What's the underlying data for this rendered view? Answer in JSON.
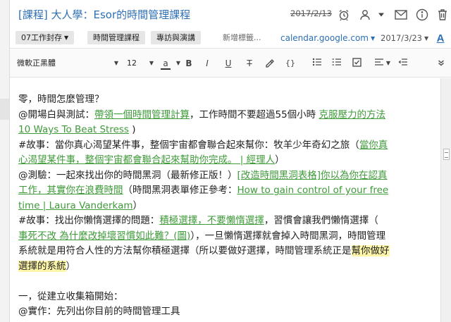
{
  "note": {
    "title": "[課程] 大人學：Esor的時間管理課程",
    "created_date": "2017/2/13",
    "tags": [
      "07工作封存",
      "時間管理課程",
      "專訪與演講"
    ],
    "new_tag_placeholder": "新增標籤...",
    "source_url": "calendar.google.com",
    "updated_date": "2017/3/23"
  },
  "icons": {
    "reminder": "alarm-clock-icon",
    "share": "share-person-icon",
    "more": "more-dropdown-icon",
    "email": "email-icon",
    "info": "info-icon",
    "delete": "trash-icon",
    "font_color_accent": "#333333",
    "link_color": "#3f9a3a",
    "title_color": "#2c6fb5",
    "highlight_color": "#fdf6a8"
  },
  "toolbar": {
    "font_family": "微軟正黑體",
    "font_size": "12",
    "font_color_label": "a",
    "bold": "B",
    "italic": "I",
    "underline": "U",
    "strikethrough": "T",
    "highlighter": "⟋",
    "code": "{}",
    "font_button": "A"
  },
  "body": {
    "l1": "零，時間怎麼管理？",
    "l2_prefix": "@開場白與測試：",
    "l2_link1": "帶領一個時間管理計算",
    "l2_mid": "，工作時間不要超過55個小時 ",
    "l2_link2": "克服壓力的方法",
    "l3_link": "10 Ways To Beat Stress",
    "l3_suffix": " )",
    "l4_prefix": "#故事：當你真心渴望某件事，整個宇宙都會聯合起來幫你：牧羊少年奇幻之旅（",
    "l4_link": "當你真",
    "l5_link": "心渴望某件事，整個宇宙都會聯合起來幫助你完成。 | 經理人",
    "l5_suffix": "）",
    "l6_prefix": "@測驗：一起來找出你的時間黑洞（最新修正版！）",
    "l6_link": "[改造時間黑洞表格]你以為你在認真",
    "l7_link": "工作，其實你在浪費時間",
    "l7_mid": "（時間黑洞表單修正參考：",
    "l7_link2": "How to gain control of your free",
    "l8_link": "time | Laura Vanderkam",
    "l8_suffix": "）",
    "l9_prefix": "#故事：找出你懶惰選擇的問題：",
    "l9_link": "積極選擇，不要懶惰選擇",
    "l9_suffix": "，習慣會讓我們懶惰選擇（",
    "l10_link": "事死不改 為什麼改掉壞習慣如此難？(圖)",
    "l10_suffix": "），一旦懶惰選擇就會掉入時間黑洞，時間管理",
    "l11_prefix": "系統就是用符合人性的方法幫你積極選擇（所以要做好選擇，時間管理系統正是",
    "l11_highlight": "幫你做好",
    "l12_highlight": "選擇的系統",
    "l12_suffix": "）",
    "l13": "",
    "l14": "一，從建立收集箱開始：",
    "l15": "@實作：先列出你目前的時間管理工具"
  }
}
